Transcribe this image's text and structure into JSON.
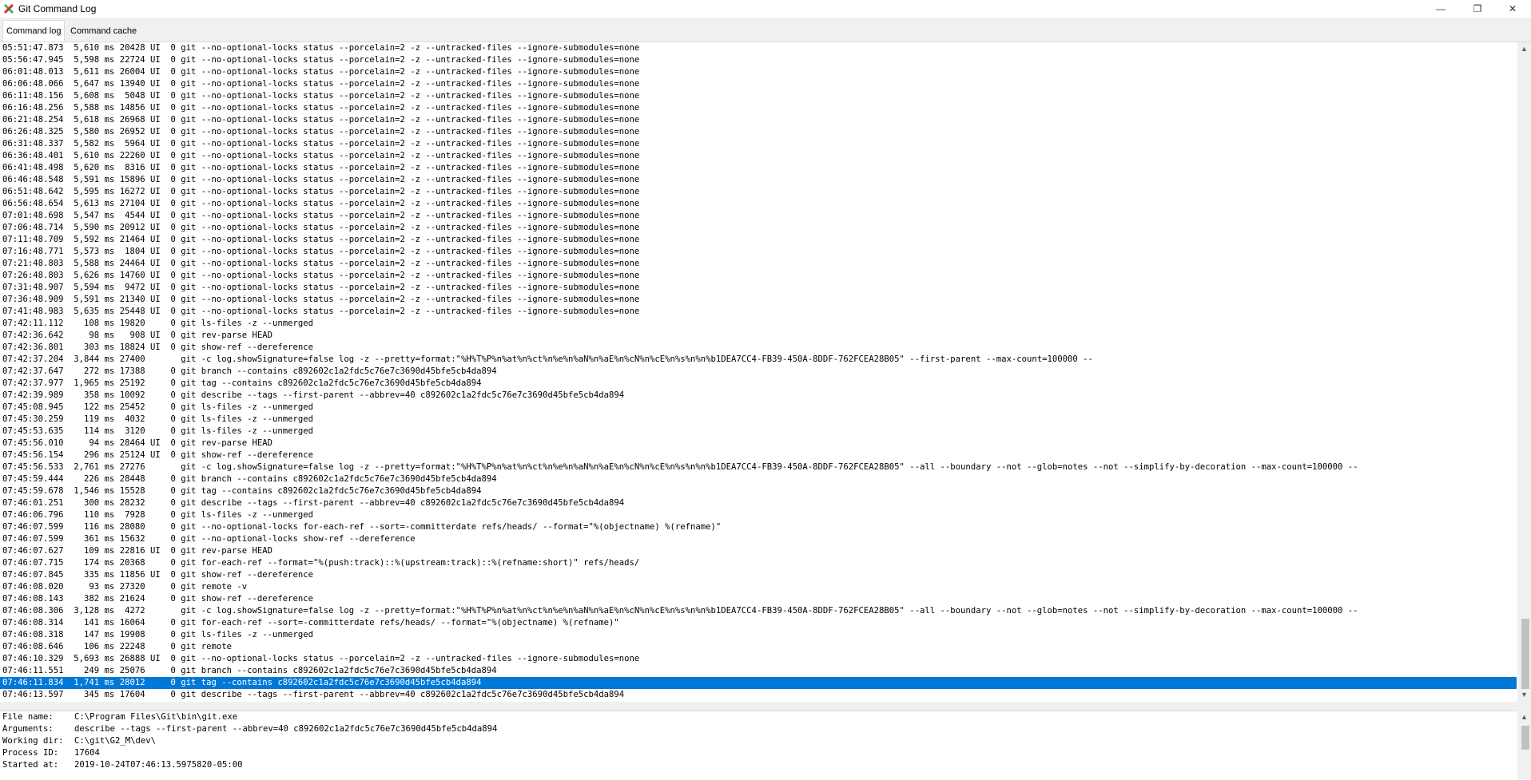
{
  "window": {
    "title": "Git Command Log",
    "minimize": "—",
    "restore": "❐",
    "close": "✕"
  },
  "tabs": [
    {
      "label": "Command log",
      "active": true
    },
    {
      "label": "Command cache",
      "active": false
    }
  ],
  "log_rows": [
    "05:51:47.873  5,610 ms 20428 UI  0 git --no-optional-locks status --porcelain=2 -z --untracked-files --ignore-submodules=none",
    "05:56:47.945  5,598 ms 22724 UI  0 git --no-optional-locks status --porcelain=2 -z --untracked-files --ignore-submodules=none",
    "06:01:48.013  5,611 ms 26004 UI  0 git --no-optional-locks status --porcelain=2 -z --untracked-files --ignore-submodules=none",
    "06:06:48.066  5,647 ms 13940 UI  0 git --no-optional-locks status --porcelain=2 -z --untracked-files --ignore-submodules=none",
    "06:11:48.156  5,608 ms  5048 UI  0 git --no-optional-locks status --porcelain=2 -z --untracked-files --ignore-submodules=none",
    "06:16:48.256  5,588 ms 14856 UI  0 git --no-optional-locks status --porcelain=2 -z --untracked-files --ignore-submodules=none",
    "06:21:48.254  5,618 ms 26968 UI  0 git --no-optional-locks status --porcelain=2 -z --untracked-files --ignore-submodules=none",
    "06:26:48.325  5,580 ms 26952 UI  0 git --no-optional-locks status --porcelain=2 -z --untracked-files --ignore-submodules=none",
    "06:31:48.337  5,582 ms  5964 UI  0 git --no-optional-locks status --porcelain=2 -z --untracked-files --ignore-submodules=none",
    "06:36:48.401  5,610 ms 22260 UI  0 git --no-optional-locks status --porcelain=2 -z --untracked-files --ignore-submodules=none",
    "06:41:48.498  5,620 ms  8316 UI  0 git --no-optional-locks status --porcelain=2 -z --untracked-files --ignore-submodules=none",
    "06:46:48.548  5,591 ms 15896 UI  0 git --no-optional-locks status --porcelain=2 -z --untracked-files --ignore-submodules=none",
    "06:51:48.642  5,595 ms 16272 UI  0 git --no-optional-locks status --porcelain=2 -z --untracked-files --ignore-submodules=none",
    "06:56:48.654  5,613 ms 27104 UI  0 git --no-optional-locks status --porcelain=2 -z --untracked-files --ignore-submodules=none",
    "07:01:48.698  5,547 ms  4544 UI  0 git --no-optional-locks status --porcelain=2 -z --untracked-files --ignore-submodules=none",
    "07:06:48.714  5,590 ms 20912 UI  0 git --no-optional-locks status --porcelain=2 -z --untracked-files --ignore-submodules=none",
    "07:11:48.709  5,592 ms 21464 UI  0 git --no-optional-locks status --porcelain=2 -z --untracked-files --ignore-submodules=none",
    "07:16:48.771  5,573 ms  1804 UI  0 git --no-optional-locks status --porcelain=2 -z --untracked-files --ignore-submodules=none",
    "07:21:48.803  5,588 ms 24464 UI  0 git --no-optional-locks status --porcelain=2 -z --untracked-files --ignore-submodules=none",
    "07:26:48.803  5,626 ms 14760 UI  0 git --no-optional-locks status --porcelain=2 -z --untracked-files --ignore-submodules=none",
    "07:31:48.907  5,594 ms  9472 UI  0 git --no-optional-locks status --porcelain=2 -z --untracked-files --ignore-submodules=none",
    "07:36:48.909  5,591 ms 21340 UI  0 git --no-optional-locks status --porcelain=2 -z --untracked-files --ignore-submodules=none",
    "07:41:48.983  5,635 ms 25448 UI  0 git --no-optional-locks status --porcelain=2 -z --untracked-files --ignore-submodules=none",
    "07:42:11.112    108 ms 19820     0 git ls-files -z --unmerged",
    "07:42:36.642     98 ms   908 UI  0 git rev-parse HEAD",
    "07:42:36.801    303 ms 18824 UI  0 git show-ref --dereference",
    "07:42:37.204  3,844 ms 27400       git -c log.showSignature=false log -z --pretty=format:\"%H%T%P%n%at%n%ct%n%e%n%aN%n%aE%n%cN%n%cE%n%s%n%n%b1DEA7CC4-FB39-450A-8DDF-762FCEA28B05\" --first-parent --max-count=100000 --",
    "07:42:37.647    272 ms 17388     0 git branch --contains c892602c1a2fdc5c76e7c3690d45bfe5cb4da894",
    "07:42:37.977  1,965 ms 25192     0 git tag --contains c892602c1a2fdc5c76e7c3690d45bfe5cb4da894",
    "07:42:39.989    358 ms 10092     0 git describe --tags --first-parent --abbrev=40 c892602c1a2fdc5c76e7c3690d45bfe5cb4da894",
    "07:45:08.945    122 ms 25452     0 git ls-files -z --unmerged",
    "07:45:30.259    119 ms  4032     0 git ls-files -z --unmerged",
    "07:45:53.635    114 ms  3120     0 git ls-files -z --unmerged",
    "07:45:56.010     94 ms 28464 UI  0 git rev-parse HEAD",
    "07:45:56.154    296 ms 25124 UI  0 git show-ref --dereference",
    "07:45:56.533  2,761 ms 27276       git -c log.showSignature=false log -z --pretty=format:\"%H%T%P%n%at%n%ct%n%e%n%aN%n%aE%n%cN%n%cE%n%s%n%n%b1DEA7CC4-FB39-450A-8DDF-762FCEA28B05\" --all --boundary --not --glob=notes --not --simplify-by-decoration --max-count=100000 --",
    "07:45:59.444    226 ms 28448     0 git branch --contains c892602c1a2fdc5c76e7c3690d45bfe5cb4da894",
    "07:45:59.678  1,546 ms 15528     0 git tag --contains c892602c1a2fdc5c76e7c3690d45bfe5cb4da894",
    "07:46:01.251    300 ms 28232     0 git describe --tags --first-parent --abbrev=40 c892602c1a2fdc5c76e7c3690d45bfe5cb4da894",
    "07:46:06.796    110 ms  7928     0 git ls-files -z --unmerged",
    "07:46:07.599    116 ms 28080     0 git --no-optional-locks for-each-ref --sort=-committerdate refs/heads/ --format=\"%(objectname) %(refname)\"",
    "07:46:07.599    361 ms 15632     0 git --no-optional-locks show-ref --dereference",
    "07:46:07.627    109 ms 22816 UI  0 git rev-parse HEAD",
    "07:46:07.715    174 ms 20368     0 git for-each-ref --format=\"%(push:track)::%(upstream:track)::%(refname:short)\" refs/heads/",
    "07:46:07.845    335 ms 11856 UI  0 git show-ref --dereference",
    "07:46:08.020     93 ms 27320     0 git remote -v",
    "07:46:08.143    382 ms 21624     0 git show-ref --dereference",
    "07:46:08.306  3,128 ms  4272       git -c log.showSignature=false log -z --pretty=format:\"%H%T%P%n%at%n%ct%n%e%n%aN%n%aE%n%cN%n%cE%n%s%n%n%b1DEA7CC4-FB39-450A-8DDF-762FCEA28B05\" --all --boundary --not --glob=notes --not --simplify-by-decoration --max-count=100000 --",
    "07:46:08.314    141 ms 16064     0 git for-each-ref --sort=-committerdate refs/heads/ --format=\"%(objectname) %(refname)\"",
    "07:46:08.318    147 ms 19908     0 git ls-files -z --unmerged",
    "07:46:08.646    106 ms 22248     0 git remote",
    "07:46:10.329  5,693 ms 26888 UI  0 git --no-optional-locks status --porcelain=2 -z --untracked-files --ignore-submodules=none",
    "07:46:11.551    249 ms 25076     0 git branch --contains c892602c1a2fdc5c76e7c3690d45bfe5cb4da894",
    "07:46:11.834  1,741 ms 28012     0 git tag --contains c892602c1a2fdc5c76e7c3690d45bfe5cb4da894",
    "07:46:13.597    345 ms 17604     0 git describe --tags --first-parent --abbrev=40 c892602c1a2fdc5c76e7c3690d45bfe5cb4da894"
  ],
  "selected_row_index": 53,
  "details": [
    {
      "label": "File name:",
      "value": "C:\\Program Files\\Git\\bin\\git.exe"
    },
    {
      "label": "Arguments:",
      "value": "describe --tags --first-parent --abbrev=40 c892602c1a2fdc5c76e7c3690d45bfe5cb4da894"
    },
    {
      "label": "Working dir:",
      "value": "C:\\git\\G2_M\\dev\\"
    },
    {
      "label": "Process ID:",
      "value": "17604"
    },
    {
      "label": "Started at:",
      "value": "2019-10-24T07:46:13.5975820-05:00"
    }
  ],
  "colors": {
    "selection": "#0078d7",
    "icon_green": "#4caf50",
    "icon_red": "#d32f2f"
  },
  "icons": {
    "app": "git-extensions-icon",
    "scroll_up": "arrow-up-icon",
    "scroll_down": "arrow-down-icon"
  }
}
